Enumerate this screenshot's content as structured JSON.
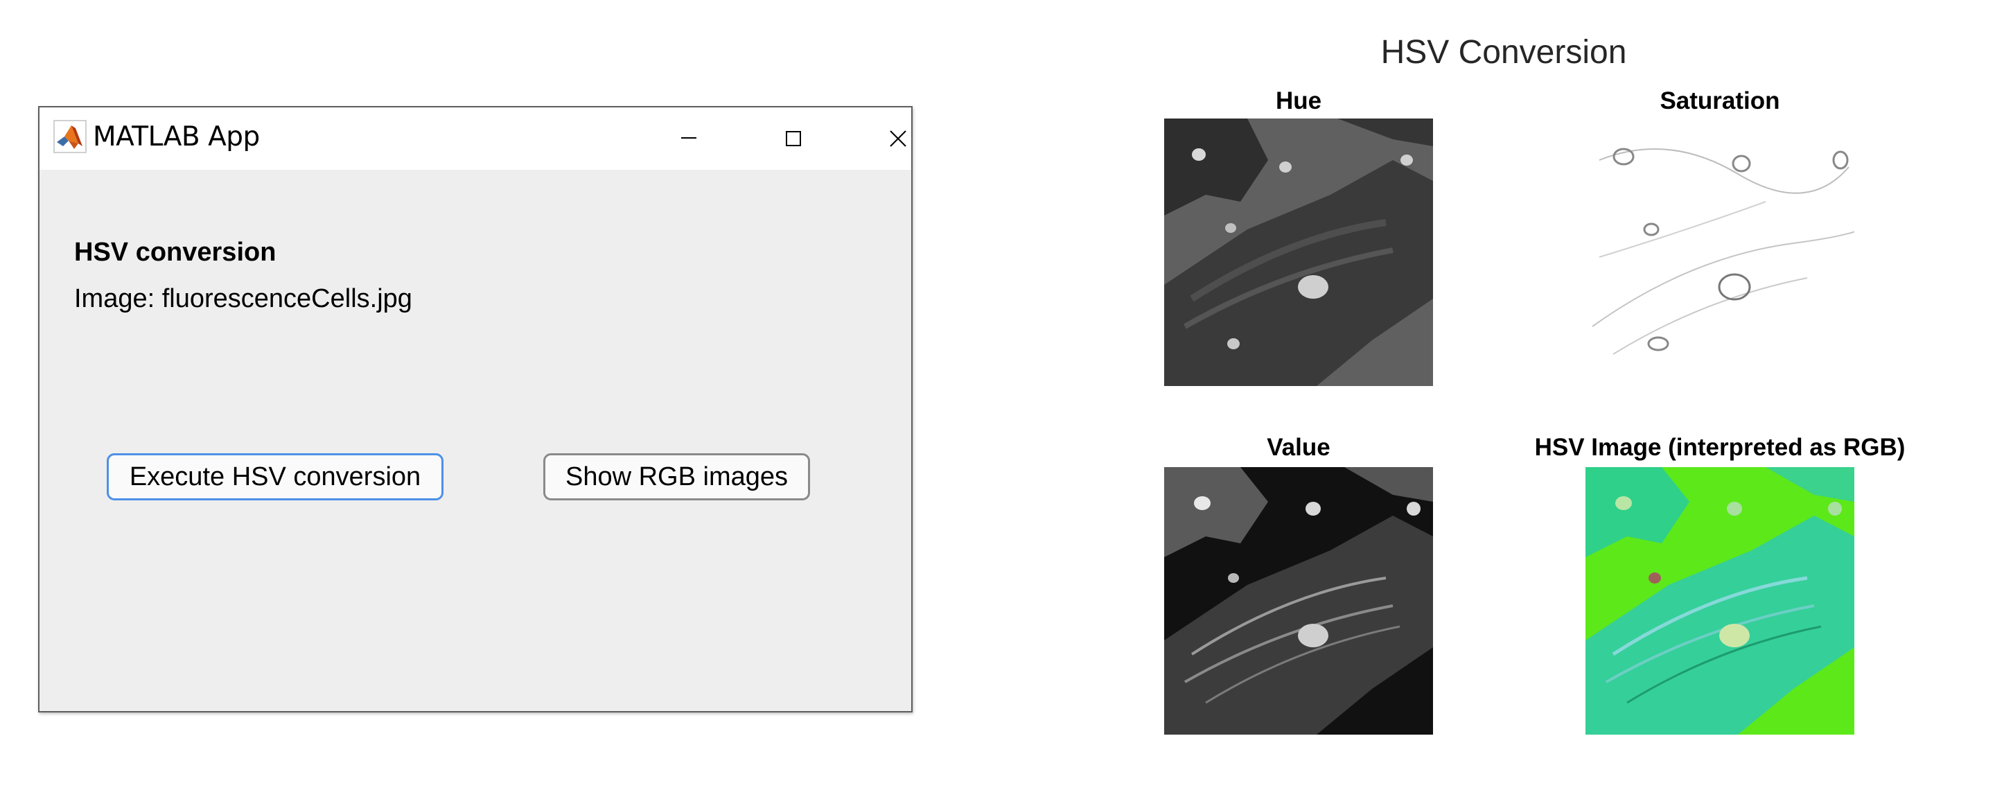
{
  "app": {
    "window_title": "MATLAB App",
    "heading": "HSV conversion",
    "image_label": "Image: fluorescenceCells.jpg",
    "buttons": {
      "execute": "Execute HSV conversion",
      "show_rgb": "Show RGB images"
    },
    "titlebar_icons": [
      "matlab-logo-icon",
      "minimize-icon",
      "maximize-icon",
      "close-icon"
    ]
  },
  "figure": {
    "title": "HSV Conversion",
    "subplots": [
      {
        "title": "Hue"
      },
      {
        "title": "Saturation"
      },
      {
        "title": "Value"
      },
      {
        "title": "HSV Image (interpreted as RGB)"
      }
    ]
  },
  "colors": {
    "window_bg": "#eeeeee",
    "titlebar_bg": "#ffffff",
    "focus_border": "#4d90e8",
    "button_border": "#8a8a8a",
    "hsv_green": "#5de81a"
  }
}
